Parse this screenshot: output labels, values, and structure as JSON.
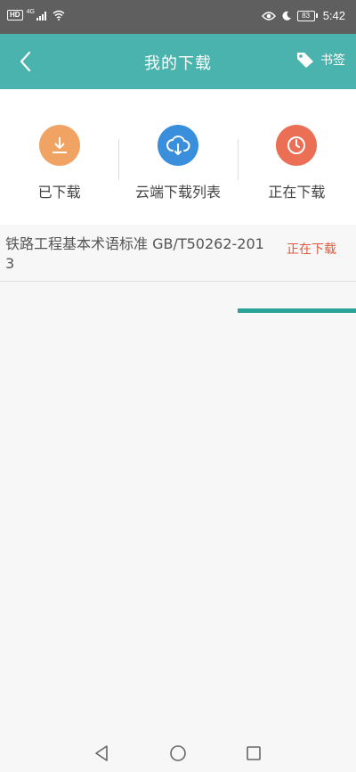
{
  "status_bar": {
    "hd_label": "HD",
    "network_label": "4G",
    "battery_level": "83",
    "time": "5:42"
  },
  "header": {
    "title": "我的下载",
    "bookmark_label": "书签",
    "accent_color": "#4ab3ad"
  },
  "tabs": [
    {
      "label": "已下载",
      "icon": "download-icon",
      "color": "#f0a363"
    },
    {
      "label": "云端下载列表",
      "icon": "cloud-download-icon",
      "color": "#3a8fdc"
    },
    {
      "label": "正在下载",
      "icon": "clock-icon",
      "color": "#ea6f55",
      "active": true
    }
  ],
  "downloads": [
    {
      "title": "铁路工程基本术语标准 GB/T50262-2013",
      "status": "正在下载"
    }
  ],
  "nav": {
    "icons": [
      "back-triangle-icon",
      "home-circle-icon",
      "recents-square-icon"
    ]
  }
}
